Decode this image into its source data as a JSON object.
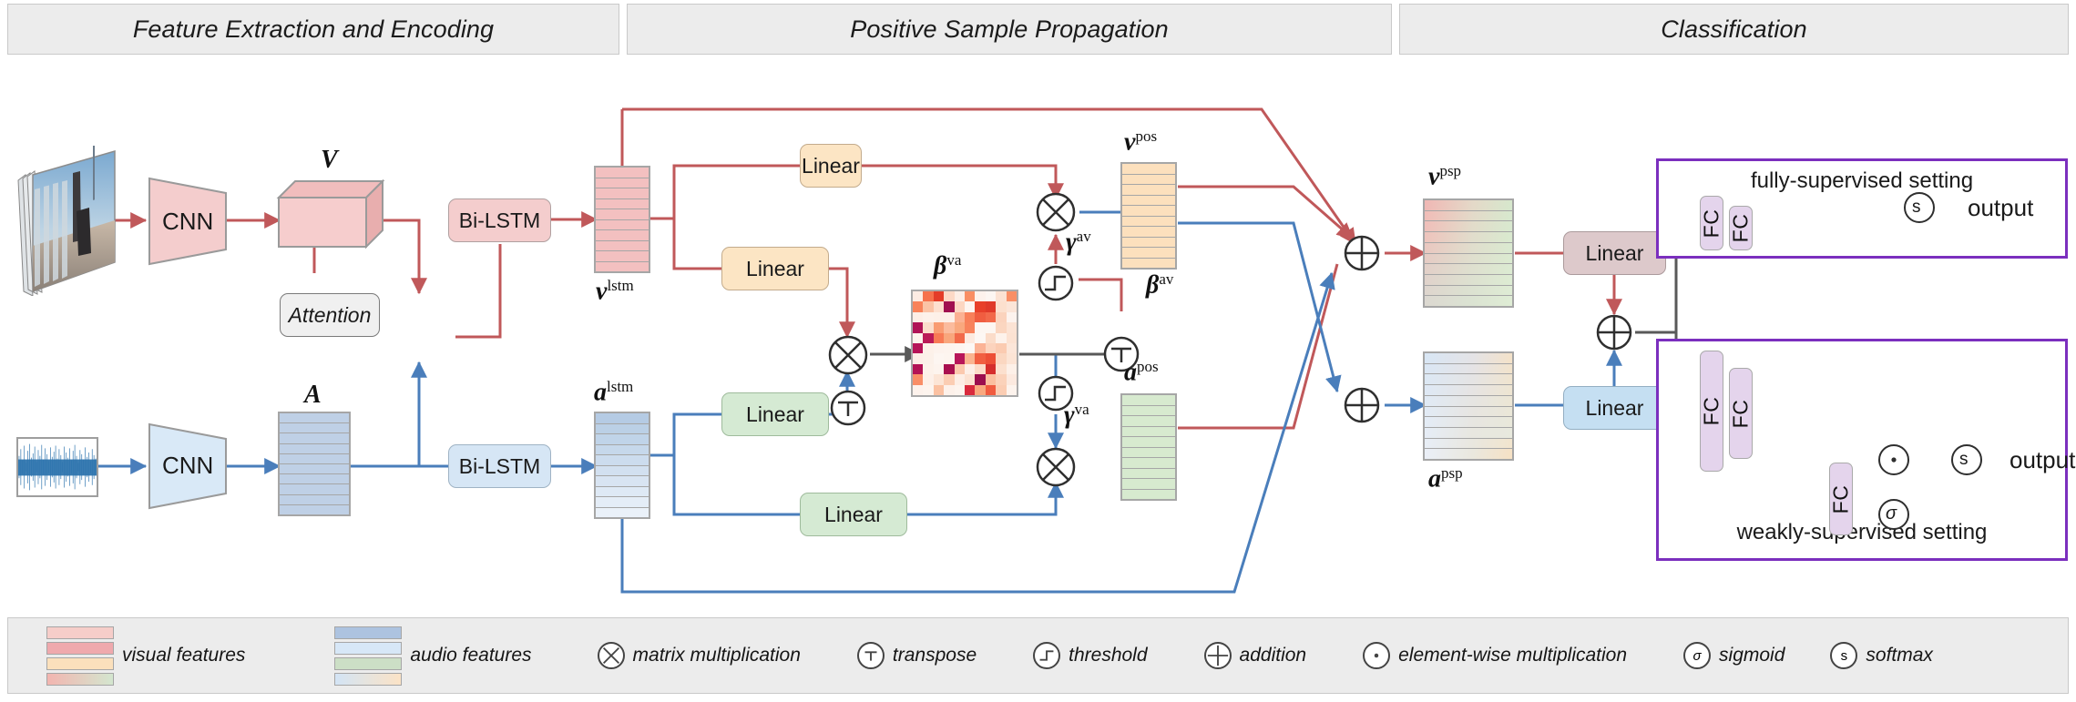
{
  "stages": [
    {
      "label": "Feature Extraction and Encoding"
    },
    {
      "label": "Positive Sample Propagation"
    },
    {
      "label": "Classification"
    }
  ],
  "encoder": {
    "visual_cnn": "CNN",
    "audio_cnn": "CNN",
    "visual_feature_label": "V",
    "audio_feature_label": "A",
    "attention": "Attention",
    "visual_bilstm": "Bi-LSTM",
    "audio_bilstm": "Bi-LSTM",
    "v_lstm_label": "v",
    "v_lstm_sup": "lstm",
    "a_lstm_label": "a",
    "a_lstm_sup": "lstm"
  },
  "psp": {
    "linear_v_top": "Linear",
    "linear_v_bottom": "Linear",
    "linear_a_top": "Linear",
    "linear_a_bottom": "Linear",
    "beta_va_label": "β",
    "beta_va_sup": "va",
    "beta_av_label": "β",
    "beta_av_sup": "av",
    "gamma_av_label": "γ",
    "gamma_av_sup": "av",
    "gamma_va_label": "γ",
    "gamma_va_sup": "va",
    "v_pos_label": "v",
    "v_pos_sup": "pos",
    "a_pos_label": "a",
    "a_pos_sup": "pos",
    "v_psp_label": "v",
    "v_psp_sup": "psp",
    "a_psp_label": "a",
    "a_psp_sup": "psp"
  },
  "classification": {
    "linear_v": "Linear",
    "linear_a": "Linear",
    "fully_supervised_caption": "fully-supervised setting",
    "weakly_supervised_caption": "weakly-supervised setting",
    "fc_label": "FC",
    "softmax_symbol": "s",
    "sigmoid_symbol": "σ",
    "elementwise_symbol": "·",
    "output_fully": "output",
    "output_weakly": "output"
  },
  "legend": [
    {
      "type": "swatch",
      "name": "visual-features",
      "text": "visual features",
      "colors": [
        "#f6cdc9",
        "#efa9ad",
        "#fbe0bc",
        "linear-gradient(90deg,#f2b5b0,#d4e6cf)"
      ]
    },
    {
      "type": "swatch",
      "name": "audio-features",
      "text": "audio features",
      "colors": [
        "#adc3e0",
        "#d7e7f7",
        "#ccdfc6",
        "linear-gradient(90deg,#d3e4f5,#fbe3c6)"
      ]
    },
    {
      "type": "op",
      "name": "matrix-multiplication",
      "symbol": "⊗",
      "text": "matrix multiplication"
    },
    {
      "type": "op",
      "name": "transpose",
      "symbol": "T",
      "text": "transpose"
    },
    {
      "type": "op",
      "name": "threshold",
      "symbol": "threshold-glyph",
      "text": "threshold"
    },
    {
      "type": "op",
      "name": "addition",
      "symbol": "⊕",
      "text": "addition"
    },
    {
      "type": "op",
      "name": "element-wise-multiplication",
      "symbol": "·",
      "text": "element-wise multiplication"
    },
    {
      "type": "op",
      "name": "sigmoid",
      "symbol": "σ",
      "text": "sigmoid"
    },
    {
      "type": "op",
      "name": "softmax",
      "symbol": "s",
      "text": "softmax"
    }
  ],
  "colors": {
    "visual_line": "#c0585a",
    "audio_line": "#4a7ebb",
    "neutral_line": "#595959",
    "purple": "#7b2fbe",
    "header_bg": "#ececec"
  }
}
